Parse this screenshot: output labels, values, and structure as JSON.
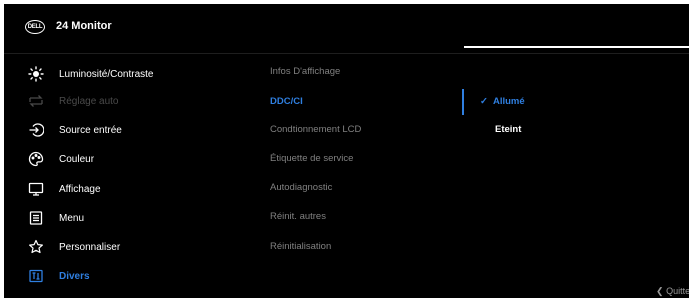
{
  "header": {
    "brand": "DELL",
    "title": "24 Monitor"
  },
  "menu": [
    {
      "label": "Luminosité/Contraste",
      "icon": "brightness-icon",
      "state": "normal"
    },
    {
      "label": "Réglage auto",
      "icon": "auto-adjust-icon",
      "state": "disabled"
    },
    {
      "label": "Source entrée",
      "icon": "input-source-icon",
      "state": "normal"
    },
    {
      "label": "Couleur",
      "icon": "color-palette-icon",
      "state": "normal"
    },
    {
      "label": "Affichage",
      "icon": "display-icon",
      "state": "normal"
    },
    {
      "label": "Menu",
      "icon": "menu-icon",
      "state": "normal"
    },
    {
      "label": "Personnaliser",
      "icon": "star-icon",
      "state": "normal"
    },
    {
      "label": "Divers",
      "icon": "others-icon",
      "state": "active"
    }
  ],
  "submenu": [
    {
      "label": "Infos D'affichage",
      "state": "normal"
    },
    {
      "label": "DDC/CI",
      "state": "active"
    },
    {
      "label": "Condtionnement LCD",
      "state": "normal"
    },
    {
      "label": "Étiquette de service",
      "state": "normal"
    },
    {
      "label": "Autodiagnostic",
      "state": "normal"
    },
    {
      "label": "Réinit. autres",
      "state": "normal"
    },
    {
      "label": "Réinitialisation",
      "state": "normal"
    }
  ],
  "options": [
    {
      "label": "Allumé",
      "selected": true,
      "check": "✓"
    },
    {
      "label": "Eteint",
      "selected": false
    }
  ],
  "footer": {
    "quit": "Quitte",
    "quit_icon": "chevron-left-icon"
  },
  "colors": {
    "accent": "#2f7fe0",
    "background": "#000000",
    "disabled": "#4a4a4a",
    "submenu_text": "#808080"
  }
}
